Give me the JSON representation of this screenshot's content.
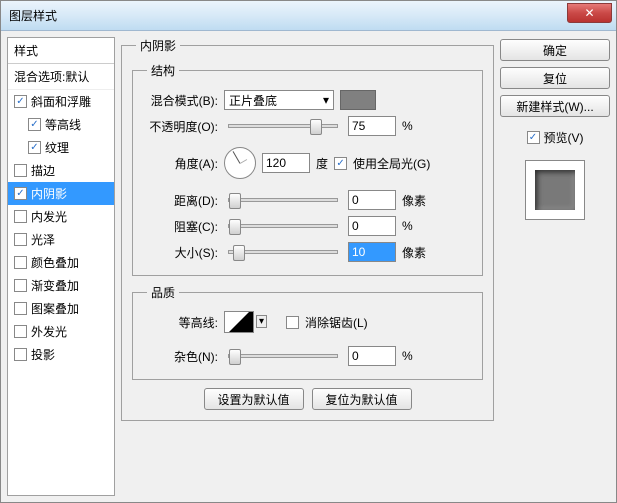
{
  "window": {
    "title": "图层样式"
  },
  "left": {
    "header": "样式",
    "subheader": "混合选项:默认",
    "items": [
      {
        "label": "斜面和浮雕",
        "checked": true,
        "selected": false,
        "indent": 0
      },
      {
        "label": "等高线",
        "checked": true,
        "selected": false,
        "indent": 1
      },
      {
        "label": "纹理",
        "checked": true,
        "selected": false,
        "indent": 1
      },
      {
        "label": "描边",
        "checked": false,
        "selected": false,
        "indent": 0
      },
      {
        "label": "内阴影",
        "checked": true,
        "selected": true,
        "indent": 0
      },
      {
        "label": "内发光",
        "checked": false,
        "selected": false,
        "indent": 0
      },
      {
        "label": "光泽",
        "checked": false,
        "selected": false,
        "indent": 0
      },
      {
        "label": "颜色叠加",
        "checked": false,
        "selected": false,
        "indent": 0
      },
      {
        "label": "渐变叠加",
        "checked": false,
        "selected": false,
        "indent": 0
      },
      {
        "label": "图案叠加",
        "checked": false,
        "selected": false,
        "indent": 0
      },
      {
        "label": "外发光",
        "checked": false,
        "selected": false,
        "indent": 0
      },
      {
        "label": "投影",
        "checked": false,
        "selected": false,
        "indent": 0
      }
    ]
  },
  "main": {
    "panel_title": "内阴影",
    "structure": {
      "legend": "结构",
      "blend_mode_label": "混合模式(B):",
      "blend_mode_value": "正片叠底",
      "opacity_label": "不透明度(O):",
      "opacity_value": "75",
      "opacity_unit": "%",
      "angle_label": "角度(A):",
      "angle_value": "120",
      "angle_unit": "度",
      "global_light_label": "使用全局光(G)",
      "global_light_checked": true,
      "distance_label": "距离(D):",
      "distance_value": "0",
      "distance_unit": "像素",
      "choke_label": "阻塞(C):",
      "choke_value": "0",
      "choke_unit": "%",
      "size_label": "大小(S):",
      "size_value": "10",
      "size_unit": "像素"
    },
    "quality": {
      "legend": "品质",
      "contour_label": "等高线:",
      "antialias_label": "消除锯齿(L)",
      "antialias_checked": false,
      "noise_label": "杂色(N):",
      "noise_value": "0",
      "noise_unit": "%"
    },
    "buttons": {
      "make_default": "设置为默认值",
      "reset_default": "复位为默认值"
    }
  },
  "right": {
    "ok": "确定",
    "reset": "复位",
    "new_style": "新建样式(W)...",
    "preview_label": "预览(V)",
    "preview_checked": true
  }
}
